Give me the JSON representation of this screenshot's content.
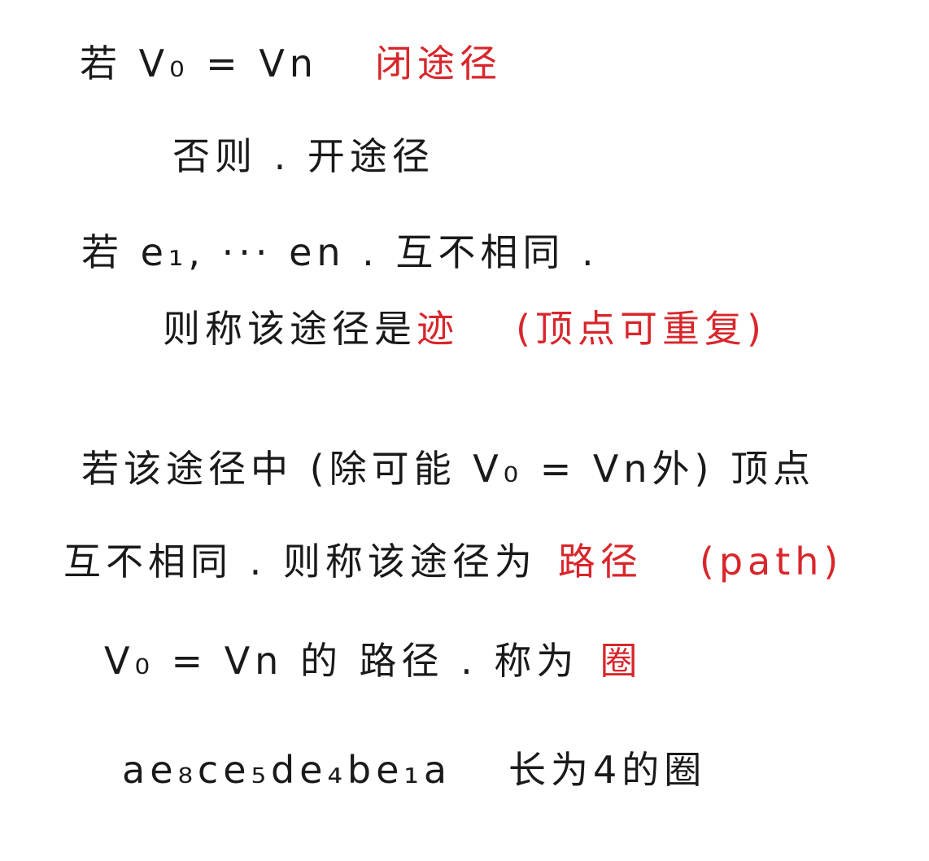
{
  "colors": {
    "ink": "#1a1a1a",
    "highlight": "#d8262b",
    "paper": "#ffffff"
  },
  "lines": {
    "l1": {
      "a": "若 V₀ = Vn",
      "b": "闭途径"
    },
    "l2": {
      "a": "否则 . 开途径"
    },
    "l3": {
      "a": "若 e₁, ··· en . 互不相同 ."
    },
    "l4": {
      "a": "则称该途径是",
      "b": "迹",
      "c": "(顶点可重复)"
    },
    "l5": {
      "a": "若该途径中 (除可能 V₀ = Vn外) 顶点"
    },
    "l6": {
      "a": "互不相同 . 则称该途径为",
      "b": "路径",
      "c": "(path)"
    },
    "l7": {
      "a": "V₀ = Vn 的 路径 . 称为",
      "b": "圈"
    },
    "l8": {
      "a": "ae₈ce₅de₄be₁a",
      "b": "长为4的圈"
    }
  }
}
